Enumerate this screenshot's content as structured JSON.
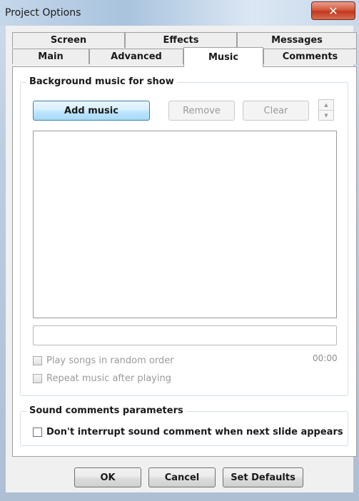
{
  "window": {
    "title": "Project Options",
    "close_icon": "close-icon"
  },
  "tabs": {
    "row1": [
      {
        "label": "Screen"
      },
      {
        "label": "Effects"
      },
      {
        "label": "Messages"
      }
    ],
    "row2": [
      {
        "label": "Main"
      },
      {
        "label": "Advanced"
      },
      {
        "label": "Music",
        "active": true
      },
      {
        "label": "Comments"
      }
    ]
  },
  "music": {
    "group_title": "Background music for show",
    "add_label": "Add music",
    "remove_label": "Remove",
    "clear_label": "Clear",
    "time": "00:00",
    "random_label": "Play songs in random order",
    "repeat_label": "Repeat music after playing"
  },
  "sound": {
    "group_title": "Sound comments parameters",
    "dont_interrupt_label": "Don't interrupt sound comment when next slide appears"
  },
  "footer": {
    "ok_label": "OK",
    "cancel_label": "Cancel",
    "defaults_label": "Set Defaults"
  },
  "colors": {
    "accent": "#3c7fb1",
    "close": "#c2381e"
  }
}
